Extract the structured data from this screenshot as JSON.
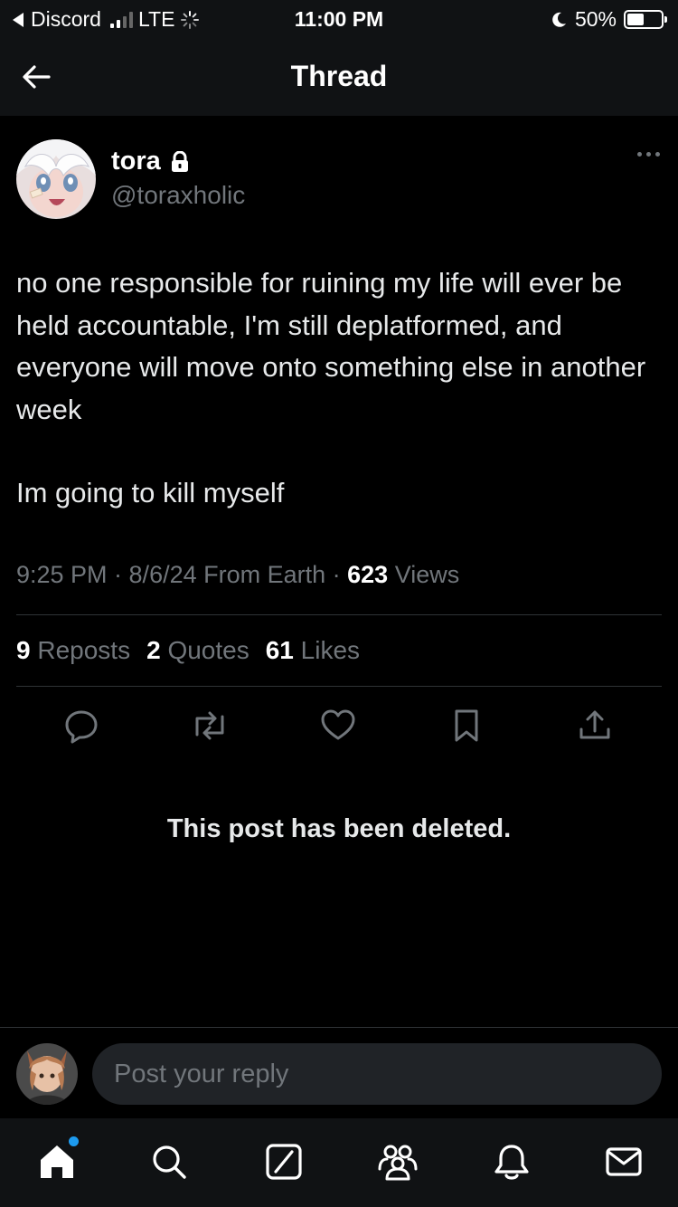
{
  "status_bar": {
    "back_app": "Discord",
    "carrier": "LTE",
    "time": "11:00 PM",
    "battery_percent": "50%",
    "battery_level": 0.5,
    "signal_bars": 2
  },
  "header": {
    "title": "Thread",
    "back_icon": "arrow-left-icon"
  },
  "post": {
    "author_name": "tora",
    "author_handle": "@toraxholic",
    "lock_icon": "lock-icon",
    "text": [
      "no one responsible for ruining my life will ever be held accountable, I'm still deplatformed, and everyone will move onto something else in another week",
      "Im going to kill myself"
    ],
    "timestamp": "9:25 PM · 8/6/24 From Earth · ",
    "views_count": "623",
    "views_label": " Views",
    "stats": {
      "reposts_count": "9",
      "reposts_label": "Reposts",
      "quotes_count": "2",
      "quotes_label": "Quotes",
      "likes_count": "61",
      "likes_label": "Likes"
    },
    "actions": [
      "reply-icon",
      "repost-icon",
      "like-icon",
      "bookmark-icon",
      "share-icon"
    ]
  },
  "deleted_notice": "This post has been deleted.",
  "reply": {
    "placeholder": "Post your reply"
  },
  "tab_bar": {
    "items": [
      "home-icon",
      "search-icon",
      "grok-icon",
      "communities-icon",
      "notifications-icon",
      "messages-icon"
    ],
    "accent": "#1d9bf0"
  },
  "colors": {
    "background": "#000000",
    "secondary_text": "#71767b",
    "divider": "#2f3336"
  }
}
